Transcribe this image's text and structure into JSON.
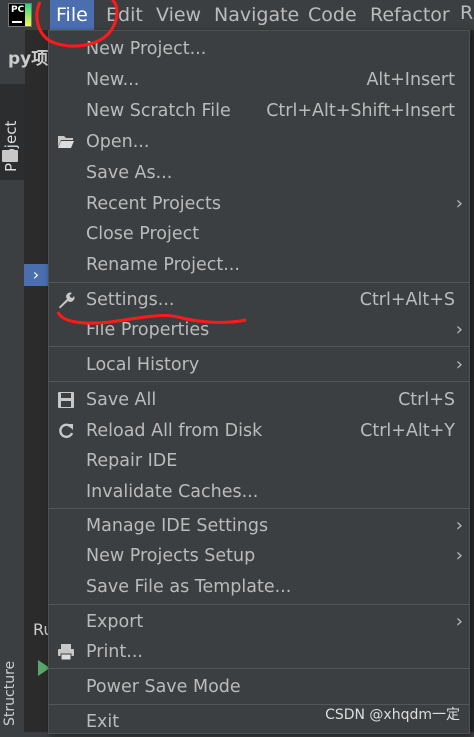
{
  "logo_text": "PC",
  "menubar": {
    "items": [
      "File",
      "Edit",
      "View",
      "Navigate",
      "Code",
      "Refactor",
      "R"
    ]
  },
  "background": {
    "project_title": "py项",
    "project_tab": "Project",
    "structure_tab": "Structure",
    "run_label": "Ru"
  },
  "file_menu": {
    "items": [
      {
        "label": "New Project...",
        "shortcut": "",
        "submenu": false
      },
      {
        "label": "New...",
        "shortcut": "Alt+Insert",
        "submenu": false
      },
      {
        "label": "New Scratch File",
        "shortcut": "Ctrl+Alt+Shift+Insert",
        "submenu": false
      },
      {
        "label": "Open...",
        "shortcut": "",
        "submenu": false,
        "icon": "folder-open-icon"
      },
      {
        "label": "Save As...",
        "shortcut": "",
        "submenu": false
      },
      {
        "label": "Recent Projects",
        "shortcut": "",
        "submenu": true
      },
      {
        "label": "Close Project",
        "shortcut": "",
        "submenu": false
      },
      {
        "label": "Rename Project...",
        "shortcut": "",
        "submenu": false
      },
      {
        "label": "Settings...",
        "shortcut": "Ctrl+Alt+S",
        "submenu": false,
        "icon": "wrench-icon"
      },
      {
        "label": "File Properties",
        "shortcut": "",
        "submenu": true
      },
      {
        "label": "Local History",
        "shortcut": "",
        "submenu": true
      },
      {
        "label": "Save All",
        "shortcut": "Ctrl+S",
        "submenu": false,
        "icon": "save-icon"
      },
      {
        "label": "Reload All from Disk",
        "shortcut": "Ctrl+Alt+Y",
        "submenu": false,
        "icon": "reload-icon"
      },
      {
        "label": "Repair IDE",
        "shortcut": "",
        "submenu": false
      },
      {
        "label": "Invalidate Caches...",
        "shortcut": "",
        "submenu": false
      },
      {
        "label": "Manage IDE Settings",
        "shortcut": "",
        "submenu": true
      },
      {
        "label": "New Projects Setup",
        "shortcut": "",
        "submenu": true
      },
      {
        "label": "Save File as Template...",
        "shortcut": "",
        "submenu": false
      },
      {
        "label": "Export",
        "shortcut": "",
        "submenu": true
      },
      {
        "label": "Print...",
        "shortcut": "",
        "submenu": false,
        "icon": "printer-icon"
      },
      {
        "label": "Power Save Mode",
        "shortcut": "",
        "submenu": false
      },
      {
        "label": "Exit",
        "shortcut": "",
        "submenu": false
      }
    ]
  },
  "watermark": "CSDN @xhqdm一定",
  "colors": {
    "menu_bg": "#3c3f41",
    "active_menu": "#4b6eaf",
    "annotation_red": "#ff1a1a"
  }
}
